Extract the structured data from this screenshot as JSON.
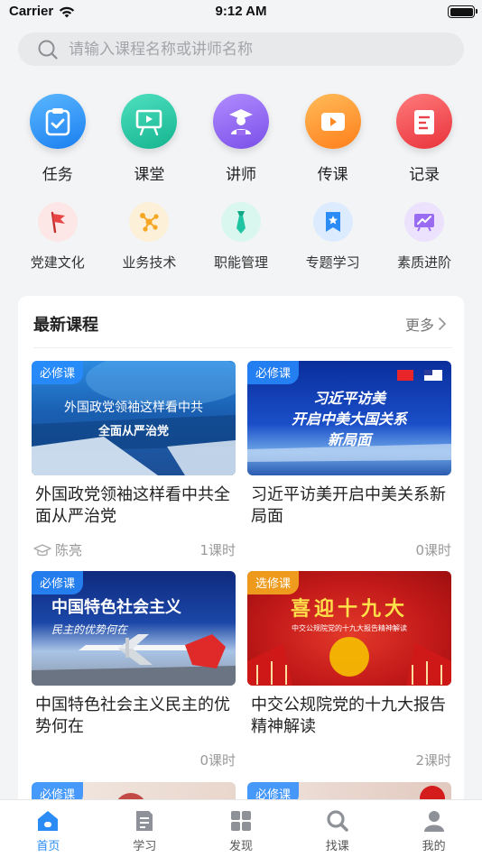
{
  "status_bar": {
    "carrier": "Carrier",
    "time": "9:12 AM"
  },
  "search": {
    "placeholder": "请输入课程名称或讲师名称"
  },
  "main_categories": [
    {
      "label": "任务",
      "icon": "clipboard-check-icon",
      "color": "#2b8cf5"
    },
    {
      "label": "课堂",
      "icon": "classroom-board-icon",
      "color": "#1fc5a3"
    },
    {
      "label": "讲师",
      "icon": "teacher-icon",
      "color": "#8a5cf0"
    },
    {
      "label": "传课",
      "icon": "video-camera-icon",
      "color": "#ff9528"
    },
    {
      "label": "记录",
      "icon": "record-document-icon",
      "color": "#f2474b"
    }
  ],
  "sub_categories": [
    {
      "label": "党建文化",
      "icon": "red-flag-icon",
      "color": "#e84545"
    },
    {
      "label": "业务技术",
      "icon": "network-nodes-icon",
      "color": "#f5a623"
    },
    {
      "label": "职能管理",
      "icon": "necktie-icon",
      "color": "#1fc5a3"
    },
    {
      "label": "专题学习",
      "icon": "bookmark-star-icon",
      "color": "#2b8cf5"
    },
    {
      "label": "素质进阶",
      "icon": "growth-chart-icon",
      "color": "#9a6cf2"
    }
  ],
  "latest": {
    "title": "最新课程",
    "more": "更多",
    "courses": [
      {
        "badge": "必修课",
        "title": "外国政党领袖这样看中共全面从严治党",
        "teacher": "陈亮",
        "hours": "1课时",
        "banner_line1": "外国政党领袖这样看中共",
        "banner_line2": "全面从严治党"
      },
      {
        "badge": "必修课",
        "title": "习近平访美开启中美关系新局面",
        "teacher": "",
        "hours": "0课时",
        "banner_line1": "习近平访美",
        "banner_line2": "开启中美大国关系",
        "banner_line3": "新局面"
      },
      {
        "badge": "必修课",
        "title": "中国特色社会主义民主的优势何在",
        "teacher": "",
        "hours": "0课时",
        "banner_line1": "中国特色社会主义",
        "banner_line2": "民主的优势何在"
      },
      {
        "badge": "选修课",
        "title": "中交公规院党的十九大报告精神解读",
        "teacher": "",
        "hours": "2课时",
        "banner_line1": "喜迎十九大",
        "banner_line2": "中交公规院党的十九大报告精神解读"
      },
      {
        "badge": "必修课",
        "title": "",
        "teacher": "",
        "hours": ""
      },
      {
        "badge": "必修课",
        "title": "",
        "teacher": "",
        "hours": ""
      }
    ]
  },
  "tabbar": [
    {
      "label": "首页",
      "icon": "home-icon",
      "active": true
    },
    {
      "label": "学习",
      "icon": "study-icon",
      "active": false
    },
    {
      "label": "发现",
      "icon": "discover-grid-icon",
      "active": false
    },
    {
      "label": "找课",
      "icon": "find-course-search-icon",
      "active": false
    },
    {
      "label": "我的",
      "icon": "profile-icon",
      "active": false
    }
  ]
}
